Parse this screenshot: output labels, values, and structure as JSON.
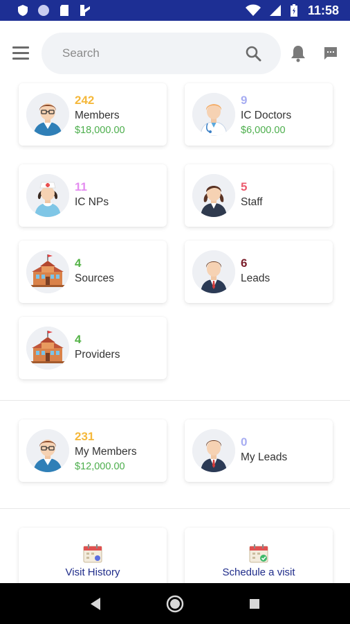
{
  "status_bar": {
    "time": "11:58"
  },
  "search": {
    "placeholder": "Search"
  },
  "stats": [
    {
      "id": "members",
      "count": "242",
      "label": "Members",
      "amount": "$18,000.00",
      "count_color": "#f5b83b",
      "icon": "doctor-glasses-avatar-icon"
    },
    {
      "id": "ic-doctors",
      "count": "9",
      "label": "IC Doctors",
      "amount": "$6,000.00",
      "count_color": "#a7adf2",
      "icon": "doctor-stethoscope-avatar-icon"
    },
    {
      "id": "ic-nps",
      "count": "11",
      "label": "IC NPs",
      "count_color": "#e48cf0",
      "icon": "nurse-avatar-icon"
    },
    {
      "id": "staff",
      "count": "5",
      "label": "Staff",
      "count_color": "#ec5b6e",
      "icon": "woman-avatar-icon"
    },
    {
      "id": "sources",
      "count": "4",
      "label": "Sources",
      "count_color": "#55b348",
      "icon": "school-building-icon"
    },
    {
      "id": "leads",
      "count": "6",
      "label": "Leads",
      "count_color": "#7a1d2a",
      "icon": "businessman-avatar-icon"
    },
    {
      "id": "providers",
      "count": "4",
      "label": "Providers",
      "count_color": "#55b348",
      "icon": "school-building-icon"
    }
  ],
  "my_stats": [
    {
      "id": "my-members",
      "count": "231",
      "label": "My Members",
      "amount": "$12,000.00",
      "count_color": "#f5b83b",
      "icon": "doctor-glasses-avatar-icon"
    },
    {
      "id": "my-leads",
      "count": "0",
      "label": "My Leads",
      "count_color": "#a7adf2",
      "icon": "businessman-avatar-icon"
    }
  ],
  "actions": [
    {
      "id": "visit-history",
      "label": "Visit History",
      "icon": "calendar-icon"
    },
    {
      "id": "schedule-visit",
      "label": "Schedule a visit",
      "icon": "calendar-check-icon"
    }
  ]
}
